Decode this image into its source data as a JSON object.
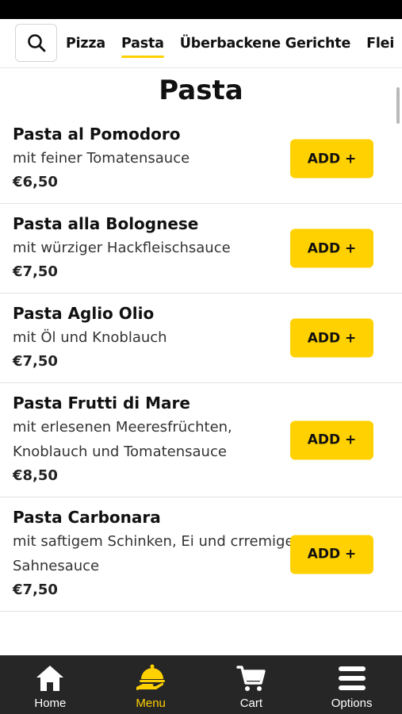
{
  "category_nav": {
    "search_icon": "search-icon",
    "tabs": [
      {
        "label": "Pizza"
      },
      {
        "label": "Pasta"
      },
      {
        "label": "Überbackene Gerichte"
      },
      {
        "label": "Flei"
      }
    ],
    "active_tab": "Pasta"
  },
  "section": {
    "title": "Pasta"
  },
  "items": [
    {
      "name": "Pasta al Pomodoro",
      "description": "mit feiner Tomatensauce",
      "price": "€6,50",
      "button": "ADD +"
    },
    {
      "name": "Pasta alla Bolognese",
      "description": "mit würziger Hackfleischsauce",
      "price": "€7,50",
      "button": "ADD +"
    },
    {
      "name": "Pasta Aglio Olio",
      "description": "mit Öl und Knoblauch",
      "price": "€7,50",
      "button": "ADD +"
    },
    {
      "name": "Pasta Frutti di Mare",
      "description": "mit erlesenen Meeresfrüchten, Knoblauch und Tomatensauce",
      "price": "€8,50",
      "button": "ADD +"
    },
    {
      "name": "Pasta Carbonara",
      "description": "mit saftigem Schinken, Ei und crremiger Sahnesauce",
      "price": "€7,50",
      "button": "ADD +"
    }
  ],
  "bottom_nav": [
    {
      "label": "Home",
      "icon": "home-icon"
    },
    {
      "label": "Menu",
      "icon": "food-tray-icon"
    },
    {
      "label": "Cart",
      "icon": "cart-icon"
    },
    {
      "label": "Options",
      "icon": "hamburger-icon"
    }
  ],
  "colors": {
    "accent": "#FFD100",
    "nav_background": "#262626",
    "status_bar": "#000000"
  }
}
